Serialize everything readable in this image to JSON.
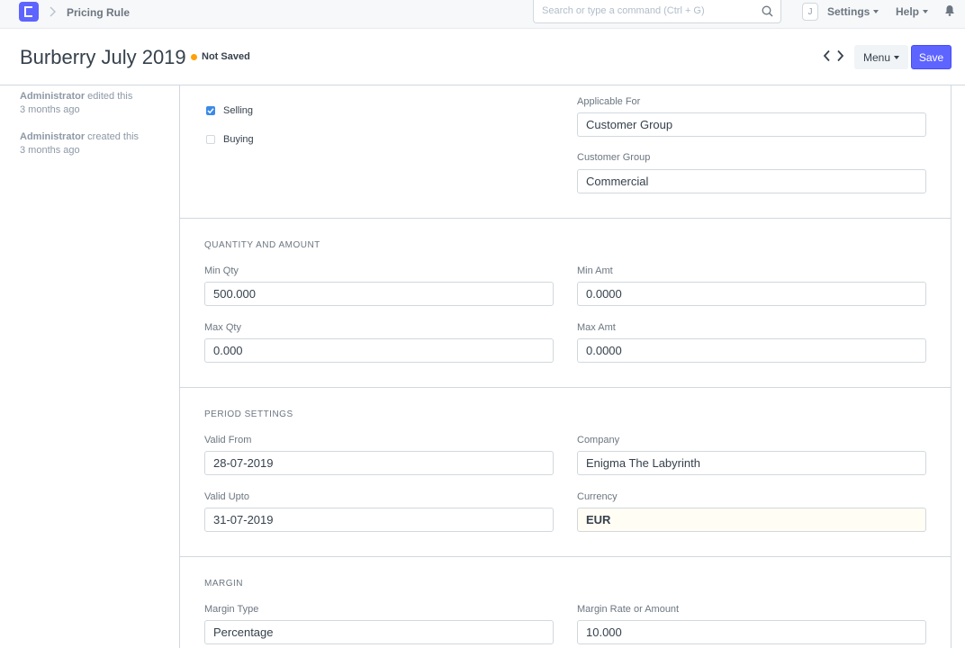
{
  "navbar": {
    "breadcrumb": "Pricing Rule",
    "search_placeholder": "Search or type a command (Ctrl + G)",
    "avatar_initial": "J",
    "settings_label": "Settings",
    "help_label": "Help"
  },
  "page": {
    "title": "Burberry July 2019",
    "status": "Not Saved",
    "menu_label": "Menu",
    "save_label": "Save"
  },
  "timeline": [
    {
      "user": "Administrator",
      "action": " edited this",
      "when": "3 months ago"
    },
    {
      "user": "Administrator",
      "action": " created this",
      "when": "3 months ago"
    }
  ],
  "applicability": {
    "selling_label": "Selling",
    "selling_checked": true,
    "buying_label": "Buying",
    "buying_checked": false,
    "applicable_for_label": "Applicable For",
    "applicable_for_value": "Customer Group",
    "customer_group_label": "Customer Group",
    "customer_group_value": "Commercial"
  },
  "quantity": {
    "heading": "QUANTITY AND AMOUNT",
    "min_qty_label": "Min Qty",
    "min_qty_value": "500.000",
    "min_amt_label": "Min Amt",
    "min_amt_value": "0.0000",
    "max_qty_label": "Max Qty",
    "max_qty_value": "0.000",
    "max_amt_label": "Max Amt",
    "max_amt_value": "0.0000"
  },
  "period": {
    "heading": "PERIOD SETTINGS",
    "valid_from_label": "Valid From",
    "valid_from_value": "28-07-2019",
    "company_label": "Company",
    "company_value": "Enigma The Labyrinth",
    "valid_upto_label": "Valid Upto",
    "valid_upto_value": "31-07-2019",
    "currency_label": "Currency",
    "currency_value": "EUR"
  },
  "margin": {
    "heading": "MARGIN",
    "margin_type_label": "Margin Type",
    "margin_type_value": "Percentage",
    "margin_rate_label": "Margin Rate or Amount",
    "margin_rate_value": "10.000"
  },
  "colors": {
    "primary": "#5e64ff",
    "indicator_orange": "#ffa00a",
    "checkbox_blue": "#3b8ae8"
  }
}
